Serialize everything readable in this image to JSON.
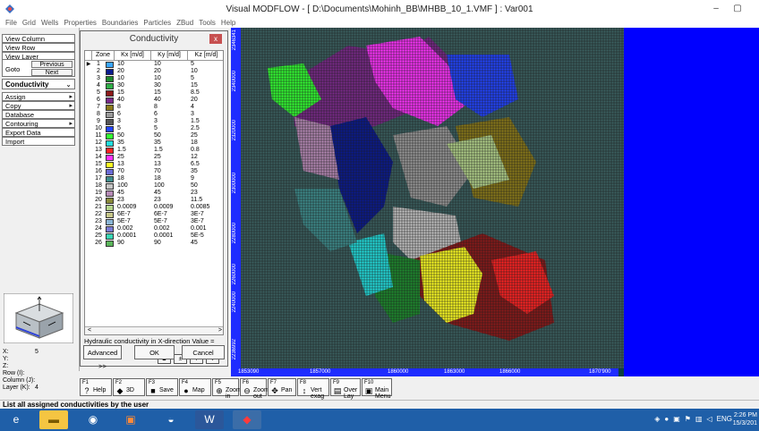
{
  "window": {
    "title": "Visual MODFLOW - [ D:\\Documents\\Mohinh_BB\\MHBB_10_1.VMF ] : Var001",
    "minimize": "–",
    "maximize": "▢"
  },
  "menu": [
    "File",
    "Grid",
    "Wells",
    "Properties",
    "Boundaries",
    "Particles",
    "ZBud",
    "Tools",
    "Help"
  ],
  "leftpanel": {
    "view_column": "View Column",
    "view_row": "View Row",
    "view_layer": "View Layer",
    "goto": "Goto",
    "previous": "Previous",
    "next": "Next",
    "property": "Conductivity",
    "assign": "Assign",
    "copy": "Copy",
    "database": "Database",
    "contouring": "Contouring",
    "export_data": "Export Data",
    "import": "Import"
  },
  "coords": {
    "x_label": "X:",
    "x_value": "5",
    "y_label": "Y:",
    "y_value": "",
    "z_label": "Z:",
    "z_value": "",
    "row_label": "Row   (I):",
    "row_value": "",
    "col_label": "Column (J):",
    "col_value": "",
    "layer_label": "Layer  (K):",
    "layer_value": "4"
  },
  "dialog": {
    "title": "Conductivity",
    "close": "x",
    "headers": {
      "zone": "Zone",
      "kx": "Kx [m/d]",
      "ky": "Ky [m/d]",
      "kz": "Kz [m/d]"
    },
    "hydraulic_text": "Hydraulic conductivity in X-direction Value =",
    "advanced": "Advanced >>",
    "ok": "OK",
    "cancel": "Cancel",
    "nav": [
      "▲",
      "±",
      "▼",
      "↕"
    ],
    "scroll_left": "<",
    "scroll_right": ">"
  },
  "zones": [
    {
      "zone": "1",
      "color": "#3aa6ff",
      "kx": "10",
      "ky": "10",
      "kz": "5"
    },
    {
      "zone": "2",
      "color": "#0a1a8f",
      "kx": "20",
      "ky": "20",
      "kz": "10"
    },
    {
      "zone": "3",
      "color": "#1e8a2e",
      "kx": "10",
      "ky": "10",
      "kz": "5"
    },
    {
      "zone": "4",
      "color": "#2fae47",
      "kx": "30",
      "ky": "30",
      "kz": "15"
    },
    {
      "zone": "5",
      "color": "#8b1a1a",
      "kx": "15",
      "ky": "15",
      "kz": "8.5"
    },
    {
      "zone": "6",
      "color": "#7a2a8a",
      "kx": "40",
      "ky": "40",
      "kz": "20"
    },
    {
      "zone": "7",
      "color": "#8a7a1a",
      "kx": "8",
      "ky": "8",
      "kz": "4"
    },
    {
      "zone": "8",
      "color": "#9a9a9a",
      "kx": "6",
      "ky": "6",
      "kz": "3"
    },
    {
      "zone": "9",
      "color": "#555555",
      "kx": "3",
      "ky": "3",
      "kz": "1.5"
    },
    {
      "zone": "10",
      "color": "#2244ff",
      "kx": "5",
      "ky": "5",
      "kz": "2.5"
    },
    {
      "zone": "11",
      "color": "#33ff33",
      "kx": "50",
      "ky": "50",
      "kz": "25"
    },
    {
      "zone": "12",
      "color": "#22dddd",
      "kx": "35",
      "ky": "35",
      "kz": "18"
    },
    {
      "zone": "13",
      "color": "#ff2222",
      "kx": "1.5",
      "ky": "1.5",
      "kz": "0.8"
    },
    {
      "zone": "14",
      "color": "#ff33ff",
      "kx": "25",
      "ky": "25",
      "kz": "12"
    },
    {
      "zone": "15",
      "color": "#ffff22",
      "kx": "13",
      "ky": "13",
      "kz": "6.5"
    },
    {
      "zone": "16",
      "color": "#6b6bd6",
      "kx": "70",
      "ky": "70",
      "kz": "35"
    },
    {
      "zone": "17",
      "color": "#3e8c8c",
      "kx": "18",
      "ky": "18",
      "kz": "9"
    },
    {
      "zone": "18",
      "color": "#c4c4c4",
      "kx": "100",
      "ky": "100",
      "kz": "50"
    },
    {
      "zone": "19",
      "color": "#b78bb7",
      "kx": "45",
      "ky": "45",
      "kz": "23"
    },
    {
      "zone": "20",
      "color": "#8a8a3a",
      "kx": "23",
      "ky": "23",
      "kz": "11.5"
    },
    {
      "zone": "21",
      "color": "#b5d58c",
      "kx": "0.0009",
      "ky": "0.0009",
      "kz": "0.0085"
    },
    {
      "zone": "22",
      "color": "#c7c78a",
      "kx": "6E-7",
      "ky": "6E-7",
      "kz": "3E-7"
    },
    {
      "zone": "23",
      "color": "#8ab5d5",
      "kx": "5E-7",
      "ky": "5E-7",
      "kz": "3E-7"
    },
    {
      "zone": "24",
      "color": "#7a7ad5",
      "kx": "0.002",
      "ky": "0.002",
      "kz": "0.001"
    },
    {
      "zone": "25",
      "color": "#3ad5b5",
      "kx": "0.0001",
      "ky": "0.0001",
      "kz": "5E-5"
    },
    {
      "zone": "26",
      "color": "#5ab55a",
      "kx": "90",
      "ky": "90",
      "kz": "45"
    }
  ],
  "map": {
    "y_ticks": [
      "2346341",
      "2340000",
      "2320000",
      "2300000",
      "2280000",
      "2260000",
      "2240000",
      "2236992"
    ],
    "x_ticks": [
      "1853090",
      "1857000",
      "1860000",
      "1863000",
      "1866000",
      "1870'900"
    ]
  },
  "fkeys": [
    {
      "key": "F1",
      "label": "Help",
      "icon": "?"
    },
    {
      "key": "F2",
      "label": "3D",
      "icon": "◆"
    },
    {
      "key": "F3",
      "label": "Save",
      "icon": "■"
    },
    {
      "key": "F4",
      "label": "Map",
      "icon": "●"
    },
    {
      "key": "F5",
      "label": "Zoom in",
      "icon": "⊕"
    },
    {
      "key": "F6",
      "label": "Zoom out",
      "icon": "⊖"
    },
    {
      "key": "F7",
      "label": "Pan",
      "icon": "✥"
    },
    {
      "key": "F8",
      "label": "Vert exag",
      "icon": "↕"
    },
    {
      "key": "F9",
      "label": "Over Lay",
      "icon": "▤"
    },
    {
      "key": "F10",
      "label": "Main Menu",
      "icon": "▣"
    }
  ],
  "status": "List all assigned conductivities by the user",
  "taskbar": {
    "lang": "ENG",
    "time": "2:26 PM",
    "date": "15/3/201"
  }
}
